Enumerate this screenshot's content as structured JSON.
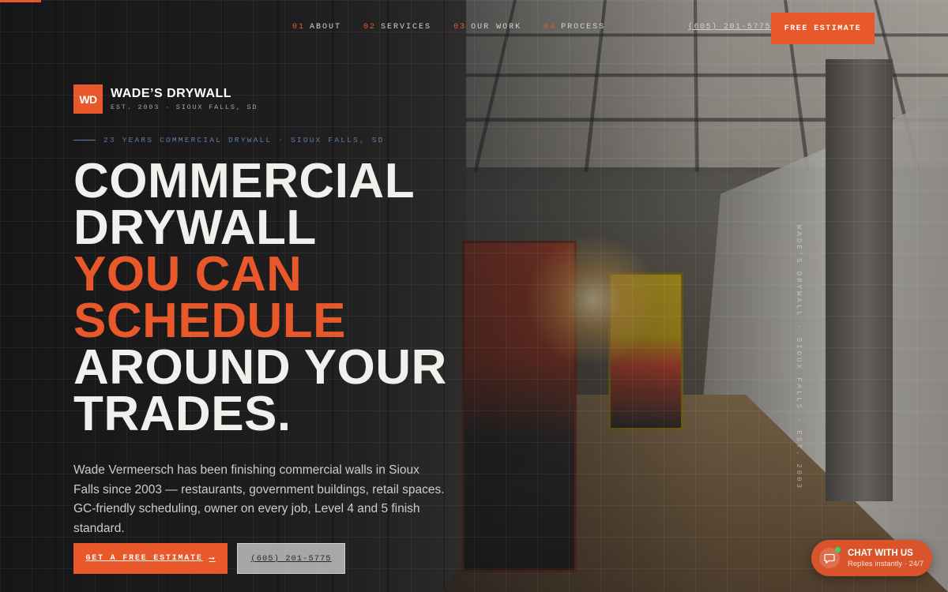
{
  "nav": {
    "items": [
      {
        "num": "01",
        "label": "ABOUT"
      },
      {
        "num": "02",
        "label": "SERVICES"
      },
      {
        "num": "03",
        "label": "OUR WORK"
      },
      {
        "num": "04",
        "label": "PROCESS"
      }
    ],
    "phone": "(605) 201-5775",
    "cta_label": "FREE ESTIMATE"
  },
  "brand": {
    "mark": "WD",
    "name": "WADE’S DRYWALL",
    "tagline": "EST. 2003 · SIOUX FALLS, SD"
  },
  "hero": {
    "eyebrow": "23 YEARS COMMERCIAL DRYWALL · SIOUX FALLS, SD",
    "headline": {
      "line1": "COMMERCIAL",
      "line2": "DRYWALL",
      "line3": "YOU CAN",
      "line4": "SCHEDULE",
      "line5": "AROUND YOUR",
      "line6": "TRADES."
    },
    "lede": "Wade Vermeersch has been finishing commercial walls in Sioux Falls since 2003 — restaurants, government buildings, retail spaces. GC-friendly scheduling, owner on every job, Level 4 and 5 finish standard.",
    "cta_primary": "GET A FREE ESTIMATE",
    "cta_primary_arrow": "⟶",
    "cta_secondary": "(605) 201-5775",
    "vertical_caption": "WADE’S DRYWALL · SIOUX FALLS · EST. 2003"
  },
  "chat": {
    "title": "CHAT WITH US",
    "subtitle": "Replies instantly · 24/7",
    "status_color": "#3fd26a"
  },
  "colors": {
    "accent": "#e8582a",
    "eyebrow": "#5d7ea8"
  },
  "icons": {
    "chat": "chat-bubble-icon",
    "arrow": "arrow-right-icon"
  }
}
